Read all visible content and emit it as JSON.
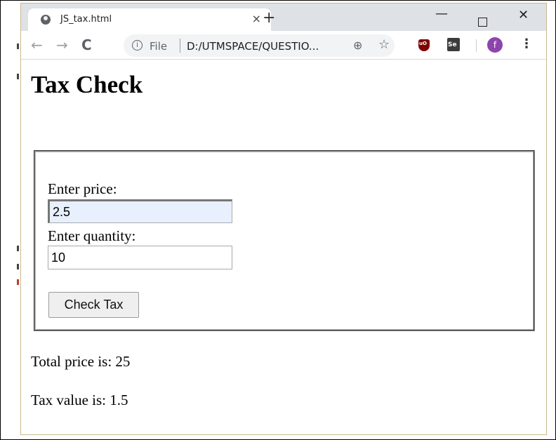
{
  "browser": {
    "tab_title": "JS_tax.html",
    "tab_close": "×",
    "new_tab": "+",
    "window_controls": {
      "minimize": "—",
      "close": "✕"
    },
    "nav": {
      "back": "←",
      "forward": "→",
      "reload": "C"
    },
    "omnibox": {
      "info_icon": "i",
      "scheme_label": "File",
      "url": "D:/UTMSPACE/QUESTIO..."
    },
    "zoom_icon": "⊕",
    "star_icon": "☆",
    "extensions": {
      "ublock_label": "uO",
      "se_label": "Se"
    },
    "avatar_letter": "f",
    "menu_icon": "⋮"
  },
  "page": {
    "title": "Tax Check",
    "form": {
      "price_label": "Enter price:",
      "price_value": "2.5",
      "quantity_label": "Enter quantity:",
      "quantity_value": "10",
      "submit_label": "Check Tax"
    },
    "results": {
      "total_price": "Total price is: 25",
      "tax_value": "Tax value is: 1.5"
    }
  },
  "colors": {
    "tab_strip": "#dee1e6",
    "focused_field_bg": "#e8f0fe",
    "avatar": "#8e44ad",
    "ublock": "#800000"
  }
}
